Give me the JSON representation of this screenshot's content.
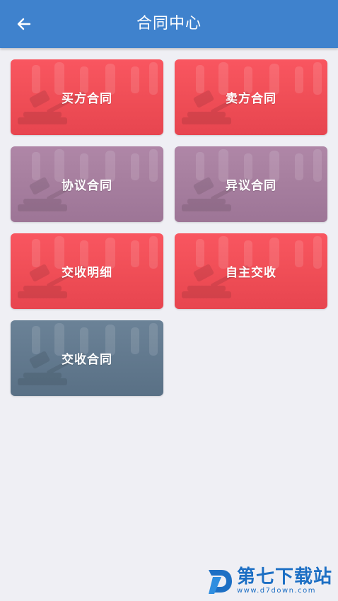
{
  "header": {
    "title": "合同中心",
    "back_icon": "arrow-left-icon",
    "color": "#3f82cd"
  },
  "cards": [
    {
      "label": "买方合同",
      "color": "#ef4650",
      "icon": "gavel-background"
    },
    {
      "label": "卖方合同",
      "color": "#ef4650",
      "icon": "gavel-background"
    },
    {
      "label": "协议合同",
      "color": "#a2789a",
      "icon": "gavel-background"
    },
    {
      "label": "异议合同",
      "color": "#a2789a",
      "icon": "gavel-background"
    },
    {
      "label": "交收明细",
      "color": "#ef4650",
      "icon": "gavel-background"
    },
    {
      "label": "自主交收",
      "color": "#ef4650",
      "icon": "gavel-background"
    },
    {
      "label": "交收合同",
      "color": "#5b7389",
      "icon": "gavel-background"
    }
  ],
  "watermark": {
    "title": "第七下载站",
    "url": "www.d7down.com"
  }
}
